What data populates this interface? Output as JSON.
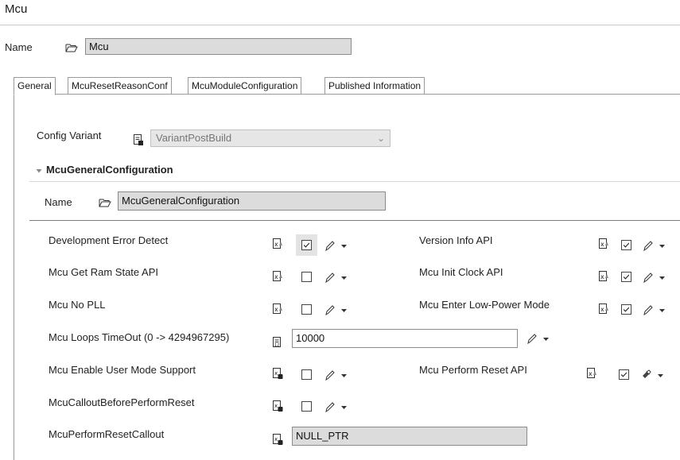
{
  "title": "Mcu",
  "name_label": "Name",
  "name_value": "Mcu",
  "tabs": [
    {
      "label": "General"
    },
    {
      "label": "McuResetReasonConf"
    },
    {
      "label": "McuModuleConfiguration"
    },
    {
      "label": "Published Information"
    }
  ],
  "config_variant": {
    "label": "Config Variant",
    "value": "VariantPostBuild"
  },
  "section": {
    "title": "McuGeneralConfiguration",
    "name_label": "Name",
    "name_value": "McuGeneralConfiguration"
  },
  "params_left": [
    {
      "label": "Development Error Detect",
      "checked": true
    },
    {
      "label": "Mcu Get Ram State API",
      "checked": false
    },
    {
      "label": "Mcu No PLL",
      "checked": false
    },
    {
      "label": "Mcu Loops TimeOut (0 -> 4294967295)",
      "value": "10000"
    },
    {
      "label": "Mcu Enable User Mode Support",
      "checked": false
    },
    {
      "label": "McuCalloutBeforePerformReset",
      "checked": false
    },
    {
      "label": "McuPerformResetCallout",
      "value": "NULL_PTR"
    }
  ],
  "params_right": [
    {
      "label": "Version Info API",
      "checked": true
    },
    {
      "label": "Mcu Init Clock API",
      "checked": true
    },
    {
      "label": "Mcu Enter Low-Power Mode",
      "checked": true
    },
    {
      "label": "Mcu Perform Reset API",
      "checked": true
    }
  ],
  "icons": {
    "folder": "folder-open-icon",
    "boolean": "boolean-param-icon",
    "text": "text-param-icon",
    "function": "function-param-icon",
    "edit": "pencil-icon",
    "dropdown": "dropdown-arrow-icon",
    "expand": "collapse-triangle-icon"
  }
}
